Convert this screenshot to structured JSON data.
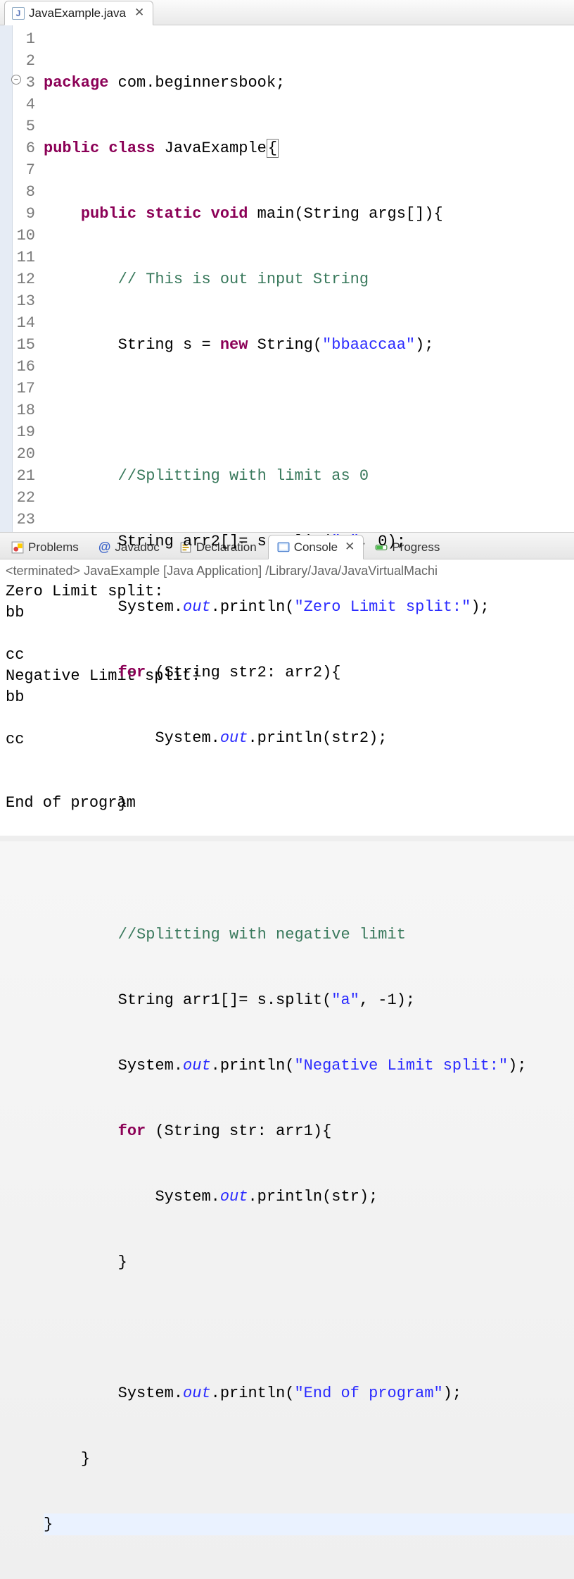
{
  "editor": {
    "tab_label": "JavaExample.java",
    "lines": {
      "count": 23,
      "fold_at": 3
    },
    "code": {
      "l1": {
        "a": "package",
        "b": " com.beginnersbook;"
      },
      "l2": {
        "a": "public",
        "b": " ",
        "c": "class",
        "d": " JavaExample",
        "lb": "{"
      },
      "l3": {
        "pad": "    ",
        "a": "public",
        "b": " ",
        "c": "static",
        "d": " ",
        "e": "void",
        "f": " main(String args[]){"
      },
      "l4": {
        "pad": "        ",
        "c": "// This is out input String"
      },
      "l5": {
        "pad": "        ",
        "a": "String s = ",
        "b": "new",
        "c": " String(",
        "s": "\"bbaaccaa\"",
        "d": ");"
      },
      "l6": {
        "pad": ""
      },
      "l7": {
        "pad": "        ",
        "c": "//Splitting with limit as 0"
      },
      "l8": {
        "pad": "        ",
        "a": "String arr2[]= s.split(",
        "s": "\"a\"",
        "b": ", 0);"
      },
      "l9": {
        "pad": "        ",
        "a": "System.",
        "f": "out",
        "b": ".println(",
        "s": "\"Zero Limit split:\"",
        "c": ");"
      },
      "l10": {
        "pad": "        ",
        "a": "for",
        "b": " (String str2: arr2){"
      },
      "l11": {
        "pad": "            ",
        "a": "System.",
        "f": "out",
        "b": ".println(str2);"
      },
      "l12": {
        "pad": "        ",
        "a": "}"
      },
      "l13": {
        "pad": ""
      },
      "l14": {
        "pad": "        ",
        "c": "//Splitting with negative limit"
      },
      "l15": {
        "pad": "        ",
        "a": "String arr1[]= s.split(",
        "s": "\"a\"",
        "b": ", -1);"
      },
      "l16": {
        "pad": "        ",
        "a": "System.",
        "f": "out",
        "b": ".println(",
        "s": "\"Negative Limit split:\"",
        "c": ");"
      },
      "l17": {
        "pad": "        ",
        "a": "for",
        "b": " (String str: arr1){"
      },
      "l18": {
        "pad": "            ",
        "a": "System.",
        "f": "out",
        "b": ".println(str);"
      },
      "l19": {
        "pad": "        ",
        "a": "}"
      },
      "l20": {
        "pad": ""
      },
      "l21": {
        "pad": "        ",
        "a": "System.",
        "f": "out",
        "b": ".println(",
        "s": "\"End of program\"",
        "c": ");"
      },
      "l22": {
        "pad": "    ",
        "a": "}"
      },
      "l23": {
        "pad": "",
        "a": "}"
      }
    }
  },
  "bottom": {
    "tabs": {
      "problems": "Problems",
      "javadoc": "Javadoc",
      "declaration": "Declaration",
      "console": "Console",
      "progress": "Progress"
    },
    "javadoc_at": "@",
    "console_status": "<terminated> JavaExample [Java Application] /Library/Java/JavaVirtualMachi",
    "console_output": "Zero Limit split:\nbb\n\ncc\nNegative Limit split:\nbb\n\ncc\n\n\nEnd of program"
  }
}
